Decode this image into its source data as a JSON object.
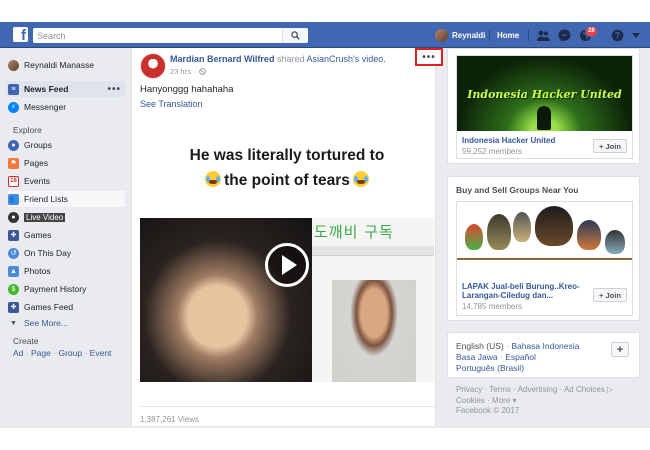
{
  "topbar": {
    "logo": "f",
    "search_placeholder": "Search",
    "user_name": "Reynaldi",
    "home_label": "Home",
    "notification_count": "28",
    "brand_color": "#4267b2"
  },
  "left_nav": {
    "profile_name": "Reynaldi Manasse",
    "news_feed": "News Feed",
    "news_feed_more": "•••",
    "messenger": "Messenger",
    "explore_title": "Explore",
    "items": [
      {
        "label": "Groups",
        "count": "2",
        "icon": "groups-icon"
      },
      {
        "label": "Pages",
        "icon": "pages-icon"
      },
      {
        "label": "Events",
        "icon": "events-icon"
      },
      {
        "label": "Friend Lists",
        "icon": "friend-lists-icon"
      },
      {
        "label": "Live Video",
        "icon": "live-video-icon"
      },
      {
        "label": "Games",
        "icon": "games-icon"
      },
      {
        "label": "On This Day",
        "icon": "on-this-day-icon"
      },
      {
        "label": "Photos",
        "icon": "photos-icon"
      },
      {
        "label": "Payment History",
        "icon": "payment-history-icon"
      },
      {
        "label": "Games Feed",
        "icon": "games-feed-icon"
      },
      {
        "label": "See More...",
        "icon": "chevron-down-icon"
      }
    ],
    "create_title": "Create",
    "create_links": [
      "Ad",
      "Page",
      "Group",
      "Event"
    ]
  },
  "post": {
    "author": "Mardian Bernard Wilfred",
    "action": "shared",
    "target": "AsianCrush",
    "suffix": "'s video.",
    "time": "23 hrs",
    "more_label": "•••",
    "text": "Hanyonggg hahahaha",
    "see_translation": "See Translation",
    "video": {
      "caption_line1": "He was literally tortured to",
      "caption_line2": "the point of tears",
      "overlay_text": "도깨비 구독"
    },
    "views": "1,387,261 Views"
  },
  "right_col": {
    "group_1": {
      "image_text": "Indonesia Hacker United",
      "name": "Indonesia Hacker United",
      "members": "59,252 members",
      "join_label": "+ Join"
    },
    "near_title": "Buy and Sell Groups Near You",
    "group_2": {
      "name_line1": "LAPAK Jual-beli Burung..Kreo-",
      "name_line2": "Larangan-Ciledug dan...",
      "members": "14,785 members",
      "join_label": "+ Join"
    },
    "languages": {
      "current": "English (US)",
      "others_line1": [
        "Bahasa Indonesia"
      ],
      "others_line2": [
        "Basa Jawa",
        "Español"
      ],
      "others_line3": [
        "Português (Brasil)"
      ],
      "add_label": "+"
    },
    "footer": {
      "line1": [
        "Privacy",
        "Terms",
        "Advertising",
        "Ad Choices"
      ],
      "line2": [
        "Cookies",
        "More"
      ],
      "copyright": "Facebook © 2017"
    }
  }
}
